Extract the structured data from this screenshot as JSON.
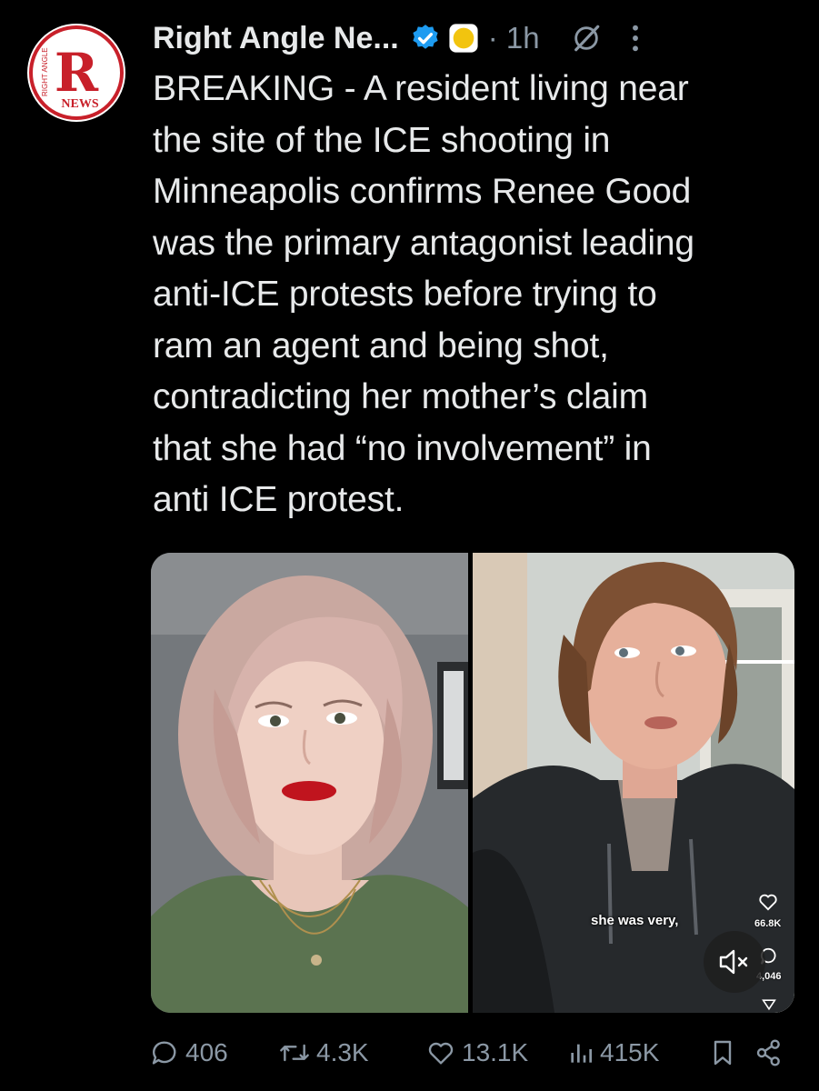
{
  "author": {
    "display_name": "Right Angle Ne...",
    "verified_icon": "verified-badge-icon",
    "affiliation_icon": "affiliate-badge-icon",
    "time": "· 1h",
    "avatar_text_main": "R",
    "avatar_text_side": "RIGHT ANGLE",
    "avatar_text_bottom": "NEWS"
  },
  "tweet": {
    "lines": [
      "BREAKING - A resident living near",
      "the site of the ICE shooting in",
      "Minneapolis confirms Renee Good",
      "was the primary antagonist leading",
      "anti-ICE protests before trying to",
      "ram an agent and being shot,",
      "contradicting her mother’s claim",
      "that she had “no involvement” in",
      "anti ICE protest."
    ]
  },
  "media": {
    "caption": "she was very,",
    "likes": "66.8K",
    "comments": "4,046"
  },
  "actions": {
    "replies": "406",
    "reposts": "4.3K",
    "likes": "13.1K",
    "views": "415K"
  },
  "colors": {
    "background": "#000000",
    "text": "#e7e9ea",
    "secondary": "#8b98a5",
    "verified": "#1d9bf0",
    "brand_red": "#c8202a"
  }
}
